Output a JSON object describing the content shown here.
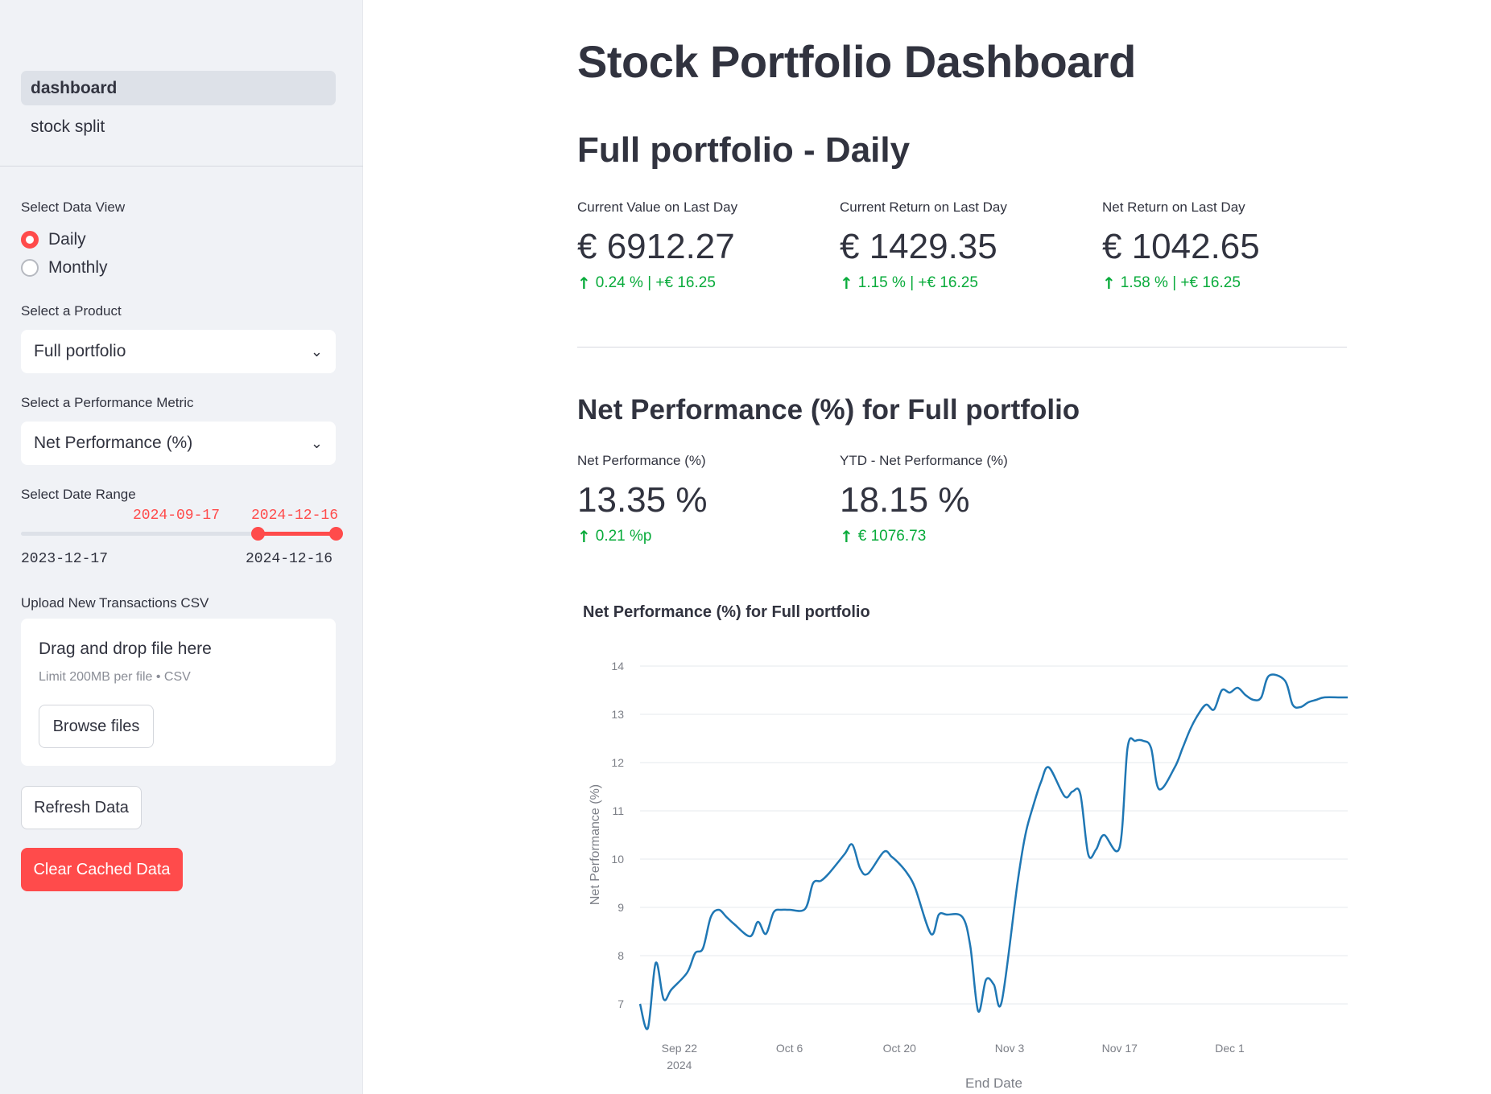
{
  "sidebar": {
    "nav": [
      {
        "label": "dashboard",
        "active": true
      },
      {
        "label": "stock split",
        "active": false
      }
    ],
    "data_view": {
      "label": "Select Data View",
      "options": [
        {
          "label": "Daily",
          "selected": true
        },
        {
          "label": "Monthly",
          "selected": false
        }
      ]
    },
    "product": {
      "label": "Select a Product",
      "value": "Full portfolio"
    },
    "metric": {
      "label": "Select a Performance Metric",
      "value": "Net Performance (%)"
    },
    "date_range": {
      "label": "Select Date Range",
      "start": "2024-09-17",
      "end": "2024-12-16",
      "min": "2023-12-17",
      "max": "2024-12-16"
    },
    "upload": {
      "label": "Upload New Transactions CSV",
      "drop_text": "Drag and drop file here",
      "limit_text": "Limit 200MB per file • CSV",
      "browse_label": "Browse files"
    },
    "refresh_label": "Refresh Data",
    "clear_label": "Clear Cached Data"
  },
  "main": {
    "title": "Stock Portfolio Dashboard",
    "section1": {
      "title": "Full portfolio - Daily",
      "metrics": [
        {
          "label": "Current Value on Last Day",
          "value": "€ 6912.27",
          "delta": "0.24 % | +€ 16.25"
        },
        {
          "label": "Current Return on Last Day",
          "value": "€ 1429.35",
          "delta": "1.15 % | +€ 16.25"
        },
        {
          "label": "Net Return on Last Day",
          "value": "€ 1042.65",
          "delta": "1.58 % | +€ 16.25"
        }
      ]
    },
    "section2": {
      "title": "Net Performance (%) for Full portfolio",
      "metrics": [
        {
          "label": "Net Performance (%)",
          "value": "13.35 %",
          "delta": "0.21 %p"
        },
        {
          "label": "YTD - Net Performance (%)",
          "value": "18.15 %",
          "delta": "€ 1076.73"
        }
      ]
    },
    "accent_color": "#ff4b4b",
    "delta_color": "#09ab3b"
  },
  "chart_data": {
    "type": "line",
    "title": "Net Performance (%) for Full portfolio",
    "xlabel": "End Date",
    "ylabel": "Net Performance (%)",
    "x_ticks": [
      "Sep 22",
      "Oct 6",
      "Oct 20",
      "Nov 3",
      "Nov 17",
      "Dec 1"
    ],
    "x_tick_sub": [
      "2024",
      "",
      "",
      "",
      "",
      ""
    ],
    "y_ticks": [
      7,
      8,
      9,
      10,
      11,
      12,
      13,
      14
    ],
    "ylim": [
      6.3,
      14.3
    ],
    "x_range": [
      "2024-09-17",
      "2024-12-16"
    ],
    "grid": true,
    "color": "#1f77b4",
    "series": [
      {
        "x": [
          "2024-09-17",
          "2024-09-18",
          "2024-09-19",
          "2024-09-20",
          "2024-09-21",
          "2024-09-23",
          "2024-09-24",
          "2024-09-25",
          "2024-09-26",
          "2024-09-27",
          "2024-09-28",
          "2024-09-29",
          "2024-10-01",
          "2024-10-02",
          "2024-10-03",
          "2024-10-04",
          "2024-10-05",
          "2024-10-06",
          "2024-10-08",
          "2024-10-09",
          "2024-10-10",
          "2024-10-11",
          "2024-10-13",
          "2024-10-14",
          "2024-10-15",
          "2024-10-16",
          "2024-10-18",
          "2024-10-19",
          "2024-10-20",
          "2024-10-21",
          "2024-10-22",
          "2024-10-24",
          "2024-10-25",
          "2024-10-26",
          "2024-10-28",
          "2024-10-29",
          "2024-10-30",
          "2024-10-31",
          "2024-11-01",
          "2024-11-02",
          "2024-11-04",
          "2024-11-05",
          "2024-11-06",
          "2024-11-07",
          "2024-11-08",
          "2024-11-10",
          "2024-11-11",
          "2024-11-12",
          "2024-11-13",
          "2024-11-14",
          "2024-11-15",
          "2024-11-17",
          "2024-11-18",
          "2024-11-19",
          "2024-11-20",
          "2024-11-21",
          "2024-11-22",
          "2024-11-24",
          "2024-11-25",
          "2024-11-26",
          "2024-11-27",
          "2024-11-28",
          "2024-11-29",
          "2024-11-30",
          "2024-12-01",
          "2024-12-02",
          "2024-12-03",
          "2024-12-04",
          "2024-12-05",
          "2024-12-06",
          "2024-12-08",
          "2024-12-09",
          "2024-12-10",
          "2024-12-11",
          "2024-12-12",
          "2024-12-13",
          "2024-12-15",
          "2024-12-16"
        ],
        "y": [
          7.0,
          6.5,
          7.85,
          7.1,
          7.3,
          7.65,
          8.05,
          8.15,
          8.8,
          8.95,
          8.8,
          8.65,
          8.4,
          8.7,
          8.45,
          8.9,
          8.95,
          8.95,
          8.97,
          9.5,
          9.55,
          9.7,
          10.1,
          10.3,
          9.8,
          9.7,
          10.15,
          10.05,
          9.9,
          9.7,
          9.4,
          8.45,
          8.85,
          8.85,
          8.8,
          8.2,
          6.85,
          7.5,
          7.4,
          7.05,
          9.5,
          10.5,
          11.1,
          11.6,
          11.9,
          11.3,
          11.4,
          11.35,
          10.1,
          10.2,
          10.5,
          10.25,
          12.3,
          12.45,
          12.45,
          12.3,
          11.45,
          11.9,
          12.3,
          12.7,
          13.0,
          13.2,
          13.1,
          13.5,
          13.45,
          13.55,
          13.4,
          13.3,
          13.35,
          13.8,
          13.7,
          13.2,
          13.15,
          13.25,
          13.3,
          13.35,
          13.35,
          13.35
        ]
      }
    ]
  }
}
